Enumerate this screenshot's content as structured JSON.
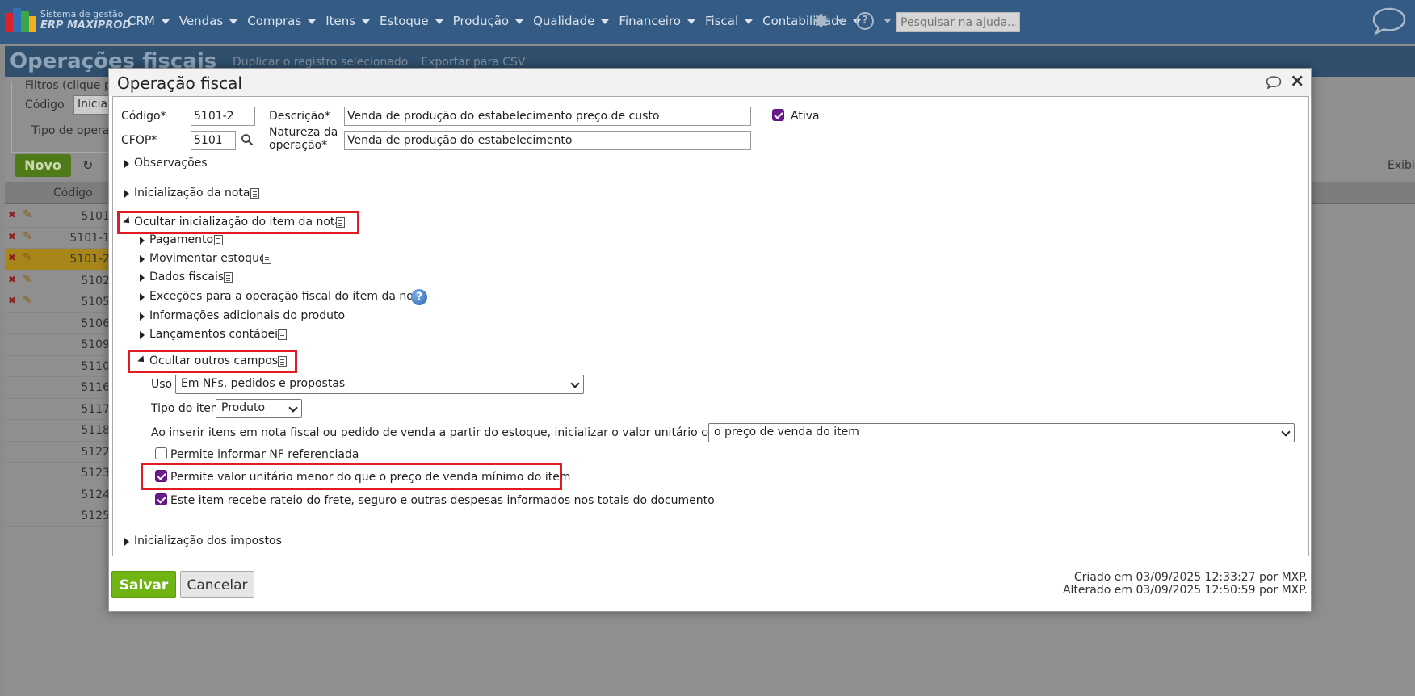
{
  "app": {
    "logo_line1": "Sistema de gestão",
    "logo_line2": "ERP MAXIPROD",
    "menu": [
      "CRM",
      "Vendas",
      "Compras",
      "Itens",
      "Estoque",
      "Produção",
      "Qualidade",
      "Financeiro",
      "Fiscal",
      "Contabilidade"
    ],
    "help_search_placeholder": "Pesquisar na ajuda...",
    "icons": {
      "settings": "gear-icon",
      "help": "question-circle-icon",
      "chat": "chat-bubble-icon"
    }
  },
  "background_page": {
    "title": "Operações fiscais",
    "toolbar": [
      "Duplicar o registro selecionado",
      "Exportar para CSV"
    ],
    "filters_legend": "Filtros (clique p",
    "filter_code_label": "Código",
    "filter_code_value": "Inicia c",
    "filter_type_label": "Tipo de operaç",
    "new_button": "Novo",
    "show_label": "Exibi",
    "column_header": "Código",
    "rows": [
      "5101",
      "5101-1",
      "5101-2",
      "5102",
      "5105",
      "5106",
      "5109",
      "5110",
      "5116",
      "5117",
      "5118",
      "5122",
      "5123",
      "5124",
      "5125"
    ]
  },
  "modal": {
    "title": "Operação fiscal",
    "codigo_label": "Código*",
    "codigo_value": "5101-2",
    "cfop_label": "CFOP*",
    "cfop_value": "5101",
    "descricao_label": "Descrição*",
    "descricao_value": "Venda de produção do estabelecimento preço de custo",
    "natureza_label_1": "Natureza da",
    "natureza_label_2": "operação*",
    "natureza_value": "Venda de produção do estabelecimento",
    "ativa_label": "Ativa",
    "ativa_checked": true,
    "sections": {
      "observacoes": "Observações",
      "inicializacao_nota": "Inicialização da nota",
      "ocultar_item": "Ocultar inicialização do item da nota",
      "pagamento": "Pagamento",
      "movimentar_estoque": "Movimentar estoque",
      "dados_fiscais": "Dados fiscais",
      "excecoes": "Exceções para a operação fiscal do item da nota",
      "info_adicionais": "Informações adicionais do produto",
      "lancamentos": "Lançamentos contábeis",
      "ocultar_outros": "Ocultar outros campos",
      "impostos": "Inicialização dos impostos"
    },
    "uso_label": "Uso",
    "uso_value": "Em NFs, pedidos e propostas",
    "tipo_item_label": "Tipo do item",
    "tipo_item_value": "Produto",
    "valor_unitario_label": "Ao inserir itens em nota fiscal ou pedido de venda a partir do estoque, inicializar o valor unitário com:",
    "valor_unitario_value": "o preço de venda do item",
    "chk_nf_referenciada": "Permite informar NF referenciada",
    "chk_nf_referenciada_checked": false,
    "chk_valor_menor": "Permite valor unitário menor do que o preço de venda mínimo do item",
    "chk_valor_menor_checked": true,
    "chk_rateio": "Este item recebe rateio do frete, seguro e outras despesas informados nos totais do documento",
    "chk_rateio_checked": true,
    "save_label": "Salvar",
    "cancel_label": "Cancelar",
    "created": "Criado em 03/09/2025 12:33:27 por MXP.",
    "changed": "Alterado em 03/09/2025 12:50:59 por MXP."
  },
  "colors": {
    "nav_bg": "#345b84",
    "highlight_red": "#e01b22",
    "checkbox_purple": "#6a1b8a",
    "save_green": "#6fb413"
  }
}
